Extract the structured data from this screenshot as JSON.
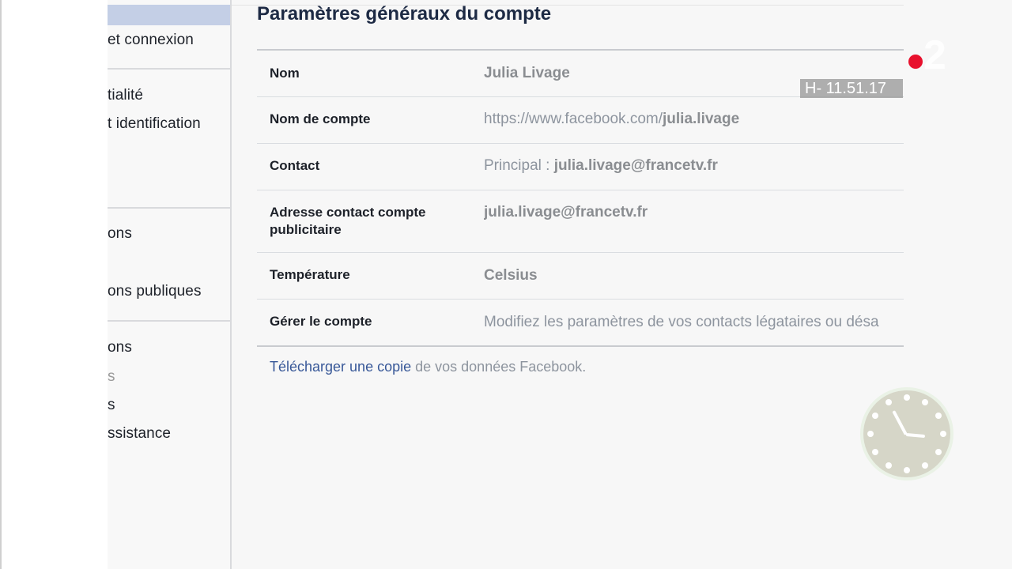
{
  "sidebar": {
    "items": [
      "et connexion",
      "tialité",
      "t identification",
      "ons",
      "ons publiques",
      "ons",
      "s",
      "s",
      "ssistance"
    ]
  },
  "main": {
    "title": "Paramètres généraux du compte",
    "rows": [
      {
        "label": "Nom",
        "value": "Julia Livage"
      },
      {
        "label": "Nom de compte",
        "value_prefix": "https://www.facebook.com/",
        "value_bold": "julia.livage"
      },
      {
        "label": "Contact",
        "value_prefix": "Principal : ",
        "value_bold": "julia.livage@francetv.fr"
      },
      {
        "label_line1": "Adresse contact compte",
        "label_line2": "publicitaire",
        "value": "julia.livage@francetv.fr"
      },
      {
        "label": "Température",
        "value": "Celsius"
      },
      {
        "label": "Gérer le compte",
        "value": "Modifiez les paramètres de vos contacts légataires ou désa"
      }
    ],
    "footer": {
      "link": "Télécharger une copie",
      "text": " de vos données Facebook."
    }
  },
  "overlay": {
    "channel_number": "2",
    "time": "H- 11.51.17",
    "accent_color": "#e8112d"
  }
}
